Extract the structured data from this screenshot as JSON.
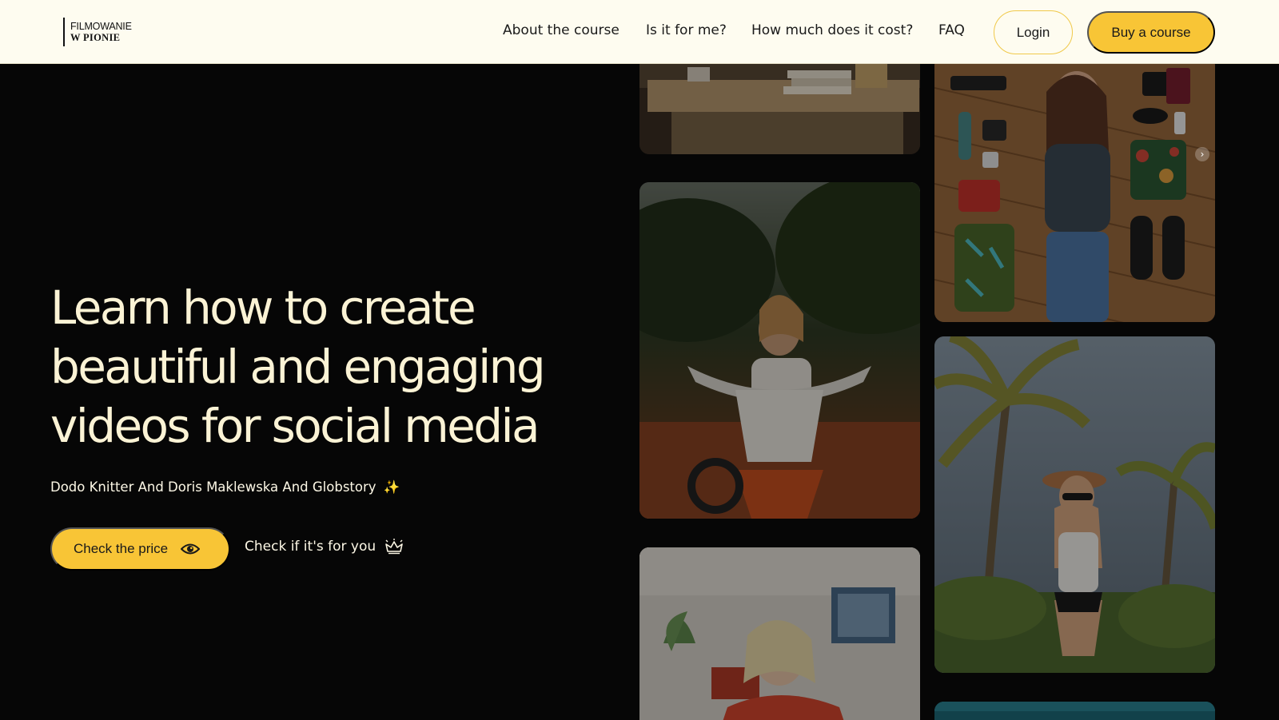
{
  "header": {
    "logo_line1": "FILMOWANIE",
    "logo_line2": "W PIONIE",
    "nav": [
      {
        "label": "About the course"
      },
      {
        "label": "Is it for me?"
      },
      {
        "label": "How much does it cost?"
      },
      {
        "label": "FAQ"
      }
    ],
    "login_label": "Login",
    "buy_label": "Buy a course"
  },
  "hero": {
    "title_lines": [
      "Learn how to create",
      "beautiful and engaging",
      "videos for social media"
    ],
    "subtitle": "Dodo Knitter And Doris Maklewska And Globstory",
    "subtitle_emoji": "✨",
    "price_button_label": "Check the price",
    "for_you_link_label": "Check if it's for you"
  },
  "gallery": {
    "photos": [
      {
        "subject": "desk-with-books"
      },
      {
        "subject": "woman-on-motorbike"
      },
      {
        "subject": "woman-indoors"
      },
      {
        "subject": "flatlay-travel-gear"
      },
      {
        "subject": "woman-with-palm-trees"
      },
      {
        "subject": "partial-photo"
      }
    ],
    "next_arrow": "›"
  },
  "colors": {
    "accent": "#f8c536",
    "header_bg": "#fefcf0",
    "page_bg": "#060606",
    "title_text": "#fbf3d5"
  },
  "icons": {
    "price_button": "eye-icon",
    "for_you_link": "crown-icon"
  }
}
